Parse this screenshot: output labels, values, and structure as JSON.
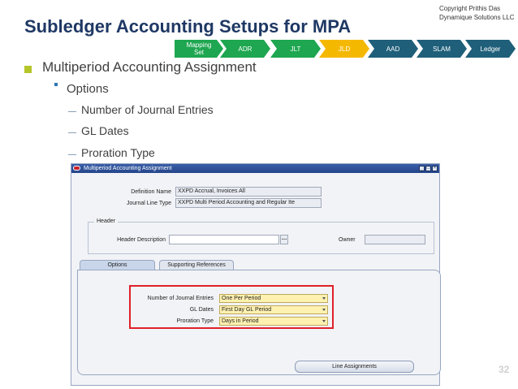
{
  "slide": {
    "title": "Subledger Accounting Setups for MPA",
    "copyright_line1": "Copyright Prithis Das",
    "copyright_line2": "Dynamique Solutions LLC",
    "page_number": "32"
  },
  "breadcrumb": [
    {
      "label": "Mapping\nSet",
      "color": "#1ea650"
    },
    {
      "label": "ADR",
      "color": "#1ea650"
    },
    {
      "label": "JLT",
      "color": "#1ea650"
    },
    {
      "label": "JLD",
      "color": "#f5b800"
    },
    {
      "label": "AAD",
      "color": "#1f5f7a"
    },
    {
      "label": "SLAM",
      "color": "#1f5f7a"
    },
    {
      "label": "Ledger",
      "color": "#1f5f7a"
    }
  ],
  "bullets": {
    "level1": "Multiperiod Accounting Assignment",
    "level2": "Options",
    "level3": [
      "Number of Journal Entries",
      "GL Dates",
      "Proration Type"
    ]
  },
  "window": {
    "title": "Multiperiod Accounting Assignment",
    "definition_name_label": "Definition Name",
    "definition_name_value": "XXPD Accrual, Invoices All",
    "journal_line_type_label": "Journal Line Type",
    "journal_line_type_value": "XXPD Multi Period Accounting and Regular Ite",
    "header_group_label": "Header",
    "header_description_label": "Header Description",
    "header_description_value": "",
    "owner_label": "Owner",
    "owner_value": "",
    "tabs": [
      "Options",
      "Supporting References"
    ],
    "options": {
      "num_journal_entries_label": "Number of Journal Entries",
      "num_journal_entries_value": "One Per Period",
      "gl_dates_label": "GL Dates",
      "gl_dates_value": "First Day GL Period",
      "proration_type_label": "Proration Type",
      "proration_type_value": "Days in Period"
    },
    "line_assignments_button": "Line Assignments"
  },
  "colors": {
    "title": "#1f3864",
    "bullet_square": "#b4c62a",
    "highlight_box": "#e0202a"
  }
}
